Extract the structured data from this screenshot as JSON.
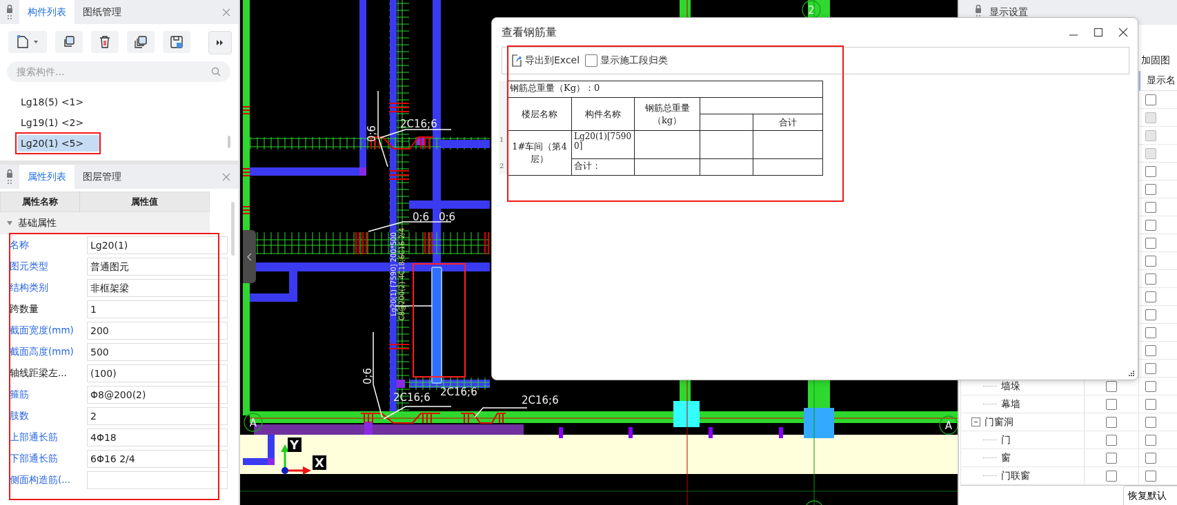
{
  "component_panel": {
    "tabs": [
      {
        "label": "构件列表",
        "selected": true
      },
      {
        "label": "图纸管理",
        "selected": false
      }
    ],
    "search": {
      "placeholder": "搜索构件..."
    },
    "items": [
      {
        "label": "Lg18(5)  <1>",
        "selected": false
      },
      {
        "label": "Lg19(1)  <2>",
        "selected": false
      },
      {
        "label": "Lg20(1)  <5>",
        "selected": true
      }
    ]
  },
  "property_panel": {
    "tabs": [
      {
        "label": "属性列表",
        "selected": true
      },
      {
        "label": "图层管理",
        "selected": false
      }
    ],
    "columns": [
      "属性名称",
      "属性值"
    ],
    "group": {
      "label": "基础属性",
      "expanded": true
    },
    "rows": [
      {
        "name": "名称",
        "value": "Lg20(1)",
        "public": true
      },
      {
        "name": "图元类型",
        "value": "普通图元",
        "public": true
      },
      {
        "name": "结构类别",
        "value": "非框架梁",
        "public": true
      },
      {
        "name": "跨数量",
        "value": "1",
        "public": false
      },
      {
        "name": "截面宽度(mm)",
        "value": "200",
        "public": true
      },
      {
        "name": "截面高度(mm)",
        "value": "500",
        "public": true
      },
      {
        "name": "轴线距梁左...",
        "value": "(100)",
        "public": false
      },
      {
        "name": "箍筋",
        "value": "Φ8@200(2)",
        "public": true
      },
      {
        "name": "肢数",
        "value": "2",
        "public": true
      },
      {
        "name": "上部通长筋",
        "value": "4Φ18",
        "public": true
      },
      {
        "name": "下部通长筋",
        "value": "6Φ16 2/4",
        "public": true
      },
      {
        "name": "侧面构造筋(...",
        "public": true
      }
    ]
  },
  "canvas": {
    "rebar_labels": [
      "2C16;6",
      "2C16;6",
      "2C16;6",
      "2C16;6"
    ],
    "angle_labels": [
      "0;6",
      "0;6",
      "0;6",
      "0;6"
    ],
    "beam_annotation": [
      "Lg20(1) [7590] 200*500",
      "C8@200(2) 4C18;6C16 2/4"
    ],
    "axis_labels": [
      "2",
      "A",
      "A"
    ],
    "coord_labels": [
      "X",
      "Y"
    ]
  },
  "dialog": {
    "title": "查看钢筋量",
    "export_button": "导出到Excel",
    "stage_checkbox": {
      "label": "显示施工段归类",
      "checked": false
    },
    "total": "钢筋总重量（Kg）：0",
    "columns": [
      "楼层名称",
      "构件名称",
      "钢筋总重量（kg）"
    ],
    "subcolumn": "合计",
    "row_numbers": [
      "1",
      "2"
    ],
    "floor": "1#车间（第4层）",
    "component": "Lg20(1)[75900]",
    "subtotal": "合计："
  },
  "display_panel": {
    "title": "显示设置",
    "tab": "加固图",
    "column": "显示名",
    "rows": [
      {
        "show_name": false,
        "disabled": false
      },
      {
        "show_name": false,
        "disabled": true
      },
      {
        "show_name": false,
        "disabled": true
      },
      {
        "show_name": false,
        "disabled": true
      },
      {
        "show_name": false,
        "disabled": false
      },
      {
        "show_name": false,
        "disabled": false
      },
      {
        "show_name": false,
        "disabled": false
      },
      {
        "show_name": false,
        "disabled": false
      },
      {
        "show_name": false,
        "disabled": false
      },
      {
        "show_name": false,
        "disabled": false
      },
      {
        "show_name": false,
        "disabled": false
      },
      {
        "show_name": false,
        "disabled": false
      },
      {
        "show_name": false,
        "disabled": false
      },
      {
        "show_name": false,
        "disabled": false
      },
      {
        "show_name": false,
        "disabled": false
      },
      {
        "show_name": false,
        "disabled": false
      }
    ],
    "tree": [
      {
        "name": "墙垛",
        "show": false,
        "show_name": false
      },
      {
        "name": "幕墙",
        "show": false,
        "show_name": false
      },
      {
        "name": "门窗洞",
        "expanded": true,
        "show": false,
        "show_name": false,
        "children": [
          {
            "name": "门",
            "show": false,
            "show_name": false
          },
          {
            "name": "窗",
            "show": false,
            "show_name": false
          },
          {
            "name": "门联窗",
            "show": false,
            "show_name": false
          }
        ]
      }
    ],
    "reset_button": "恢复默认"
  }
}
